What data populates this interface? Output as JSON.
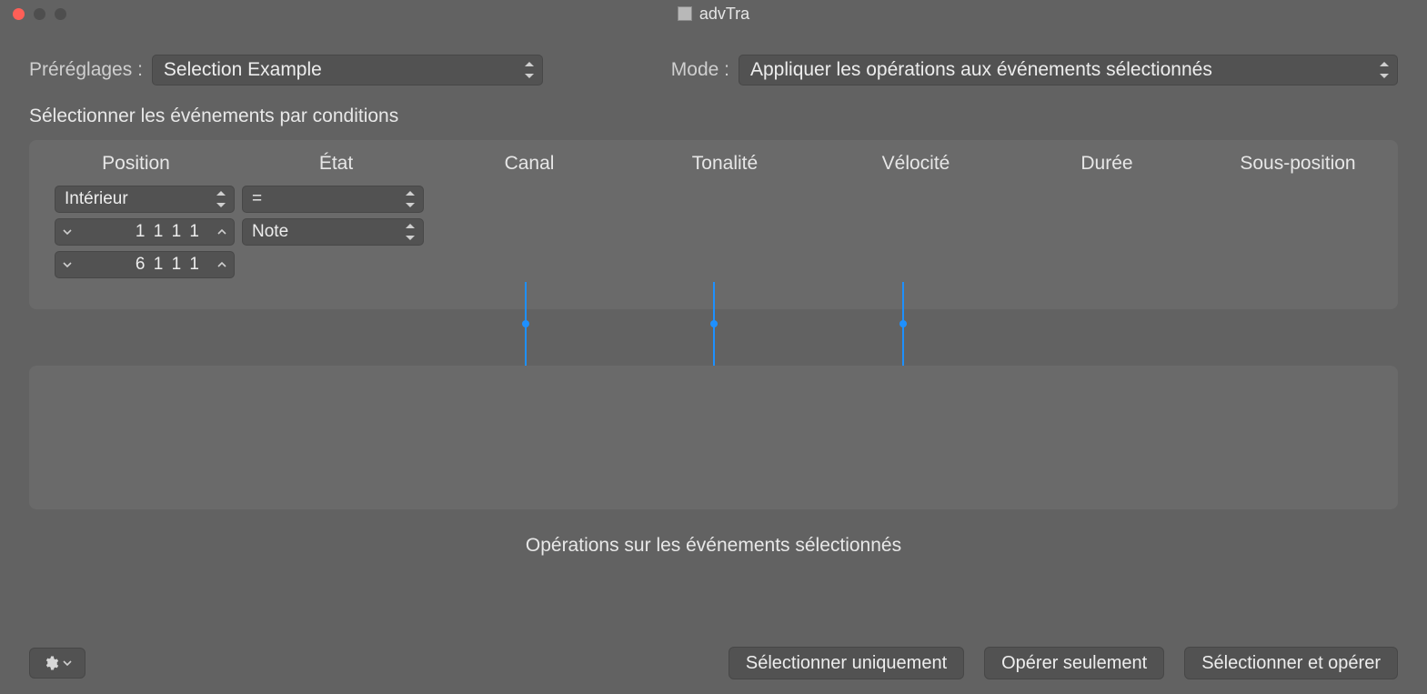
{
  "window": {
    "title": "advTra"
  },
  "top": {
    "presets_label": "Préréglages :",
    "presets_value": "Selection Example",
    "mode_label": "Mode :",
    "mode_value": "Appliquer les opérations aux événements sélectionnés"
  },
  "sections": {
    "conditions_title": "Sélectionner les événements par conditions",
    "operations_title": "Opérations sur les événements sélectionnés"
  },
  "columns": {
    "position": "Position",
    "etat": "État",
    "canal": "Canal",
    "tonalite": "Tonalité",
    "velocite": "Vélocité",
    "duree": "Durée",
    "sous_position": "Sous-position"
  },
  "conditions": {
    "position_mode": "Intérieur",
    "etat_op": "=",
    "etat_type": "Note",
    "pos_from": "1 1 1    1",
    "pos_to": "6 1 1    1"
  },
  "footer": {
    "select_only": "Sélectionner uniquement",
    "operate_only": "Opérer seulement",
    "select_and_operate": "Sélectionner et opérer"
  }
}
